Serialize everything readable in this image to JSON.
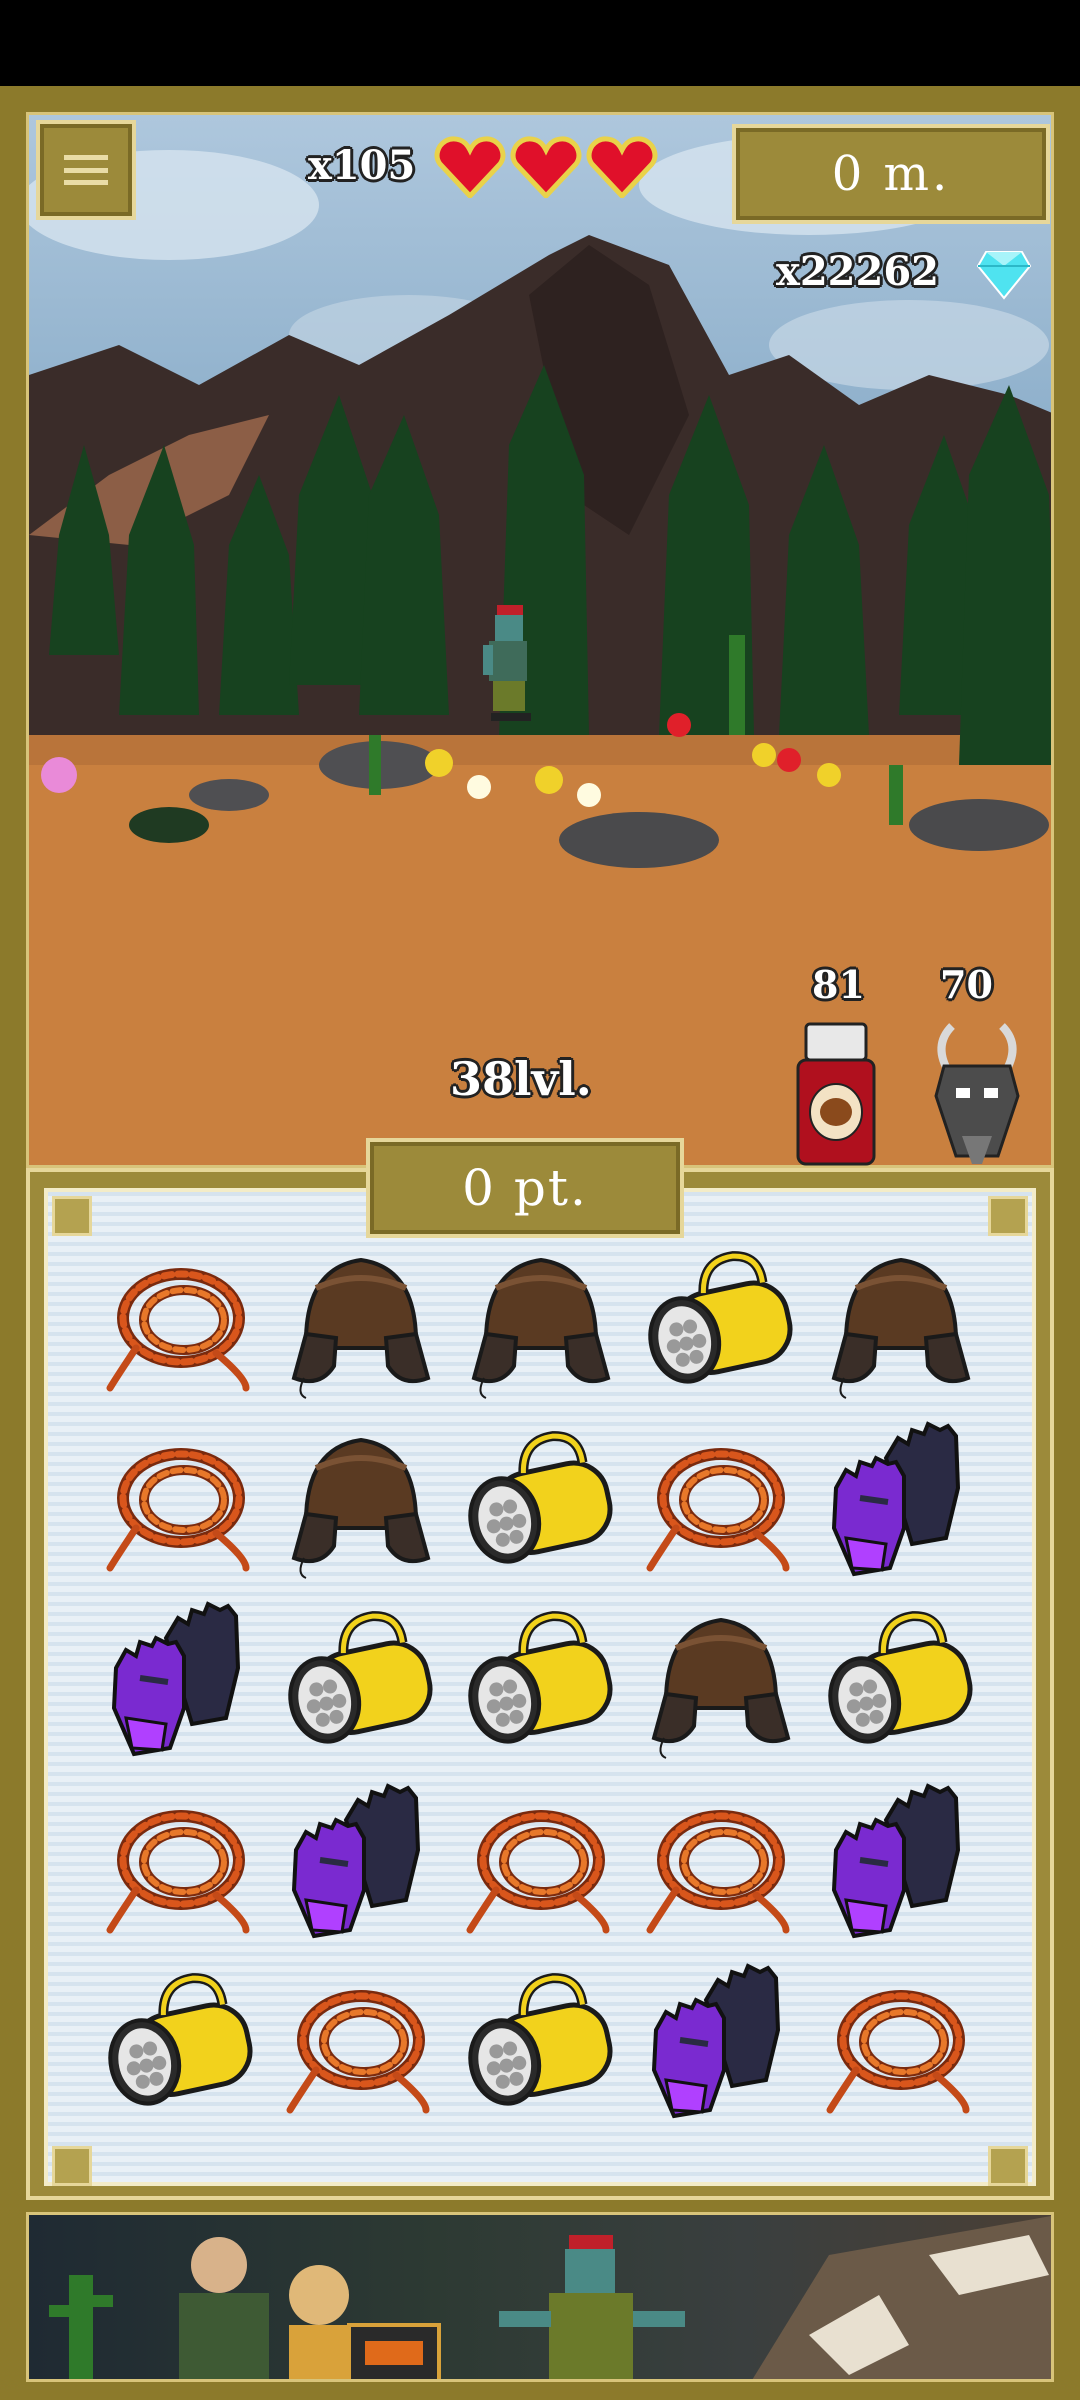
{
  "hud": {
    "lives": "x105",
    "hearts": 3,
    "distance": "0 m.",
    "gems": "x22262",
    "level": "38lvl.",
    "jar_count": "81",
    "goat_count": "70"
  },
  "board": {
    "score": "0 pt.",
    "grid": [
      [
        "rope",
        "hat",
        "hat",
        "lantern",
        "hat"
      ],
      [
        "rope",
        "hat",
        "lantern",
        "rope",
        "gloves"
      ],
      [
        "gloves",
        "lantern",
        "lantern",
        "hat",
        "lantern"
      ],
      [
        "rope",
        "gloves",
        "rope",
        "rope",
        "gloves"
      ],
      [
        "lantern",
        "rope",
        "lantern",
        "gloves",
        "rope"
      ]
    ]
  },
  "icons": {
    "menu": "menu-icon",
    "heart": "heart-icon",
    "gem": "diamond-icon",
    "jar": "jar-icon",
    "goat": "goat-icon"
  },
  "colors": {
    "frame": "#8c7a2b",
    "panel": "#9c8a3a",
    "border": "#e6d79a",
    "heart": "#e0102a",
    "gem": "#4fe3f0"
  }
}
